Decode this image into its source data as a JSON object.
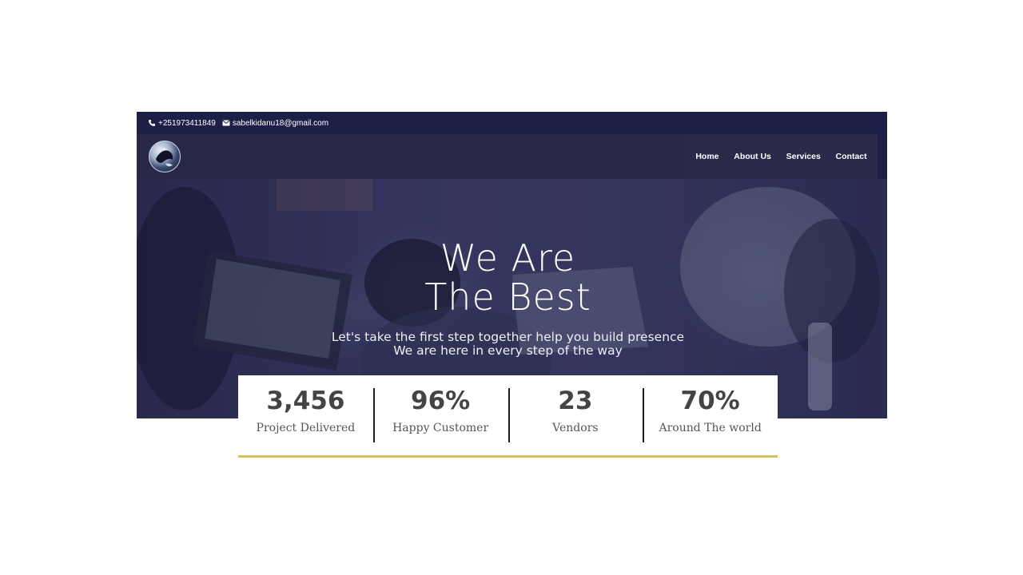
{
  "topbar": {
    "phone": "+251973411849",
    "email": "sabelkidanu18@gmail.com"
  },
  "nav": {
    "items": [
      {
        "label": "Home"
      },
      {
        "label": "About Us"
      },
      {
        "label": "Services"
      },
      {
        "label": "Contact"
      }
    ]
  },
  "hero": {
    "title_line1": "We Are",
    "title_line2": "The Best",
    "subtitle_line1": "Let's take the first step together help you build presence",
    "subtitle_line2": "We are here in every step of the way"
  },
  "stats": [
    {
      "value": "3,456",
      "label": "Project Delivered"
    },
    {
      "value": "96%",
      "label": "Happy Customer"
    },
    {
      "value": "23",
      "label": "Vendors"
    },
    {
      "value": "70%",
      "label": "Around The world"
    }
  ],
  "colors": {
    "header_bg": "#1e1f46",
    "nav_bg": "#272747",
    "accent_underline": "#d4c35a",
    "stat_text": "#444444"
  },
  "icons": {
    "phone": "phone-icon",
    "email": "envelope-icon",
    "logo": "globe-logo"
  }
}
